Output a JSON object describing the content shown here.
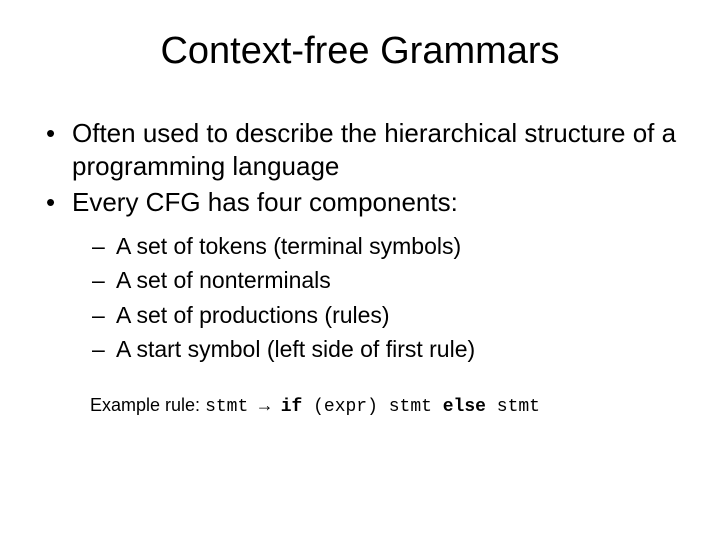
{
  "title": "Context-free Grammars",
  "bullets": [
    "Often used to describe the hierarchical structure of a programming language",
    "Every CFG has four components:"
  ],
  "subbullets": [
    "A set of tokens (terminal symbols)",
    "A set of nonterminals",
    "A set of productions (rules)",
    "A start symbol (left side of first rule)"
  ],
  "example": {
    "label": "Example rule: ",
    "lhs": "stmt",
    "arrow": " → ",
    "kw_if": "if",
    "paren_expr": " (expr) ",
    "stmt1": "stmt",
    "space1": " ",
    "kw_else": "else",
    "space2": " ",
    "stmt2": "stmt"
  }
}
